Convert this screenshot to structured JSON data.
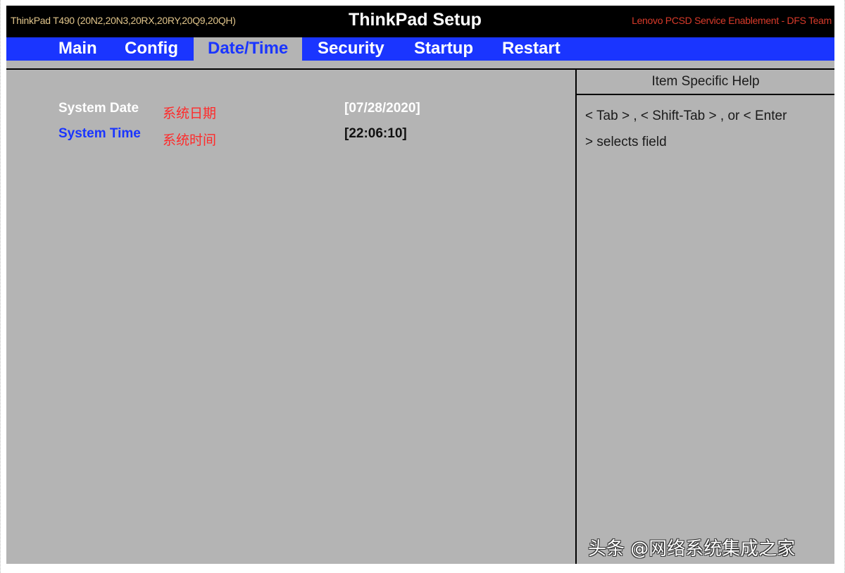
{
  "header": {
    "model": "ThinkPad T490 (20N2,20N3,20RX,20RY,20Q9,20QH)",
    "title": "ThinkPad Setup",
    "team": "Lenovo PCSD Service Enablement - DFS Team"
  },
  "menu": {
    "tabs": [
      {
        "label": "Main"
      },
      {
        "label": "Config"
      },
      {
        "label": "Date/Time",
        "active": true
      },
      {
        "label": "Security"
      },
      {
        "label": "Startup"
      },
      {
        "label": "Restart"
      }
    ]
  },
  "settings": {
    "date": {
      "label": "System Date",
      "annotation": "系统日期",
      "value": "[07/28/2020]"
    },
    "time": {
      "label": "System Time",
      "annotation": "系统时间",
      "value": "[22:06:10]"
    }
  },
  "help": {
    "title": "Item Specific Help",
    "lines": [
      "< Tab > , < Shift-Tab > , or < Enter",
      "> selects field"
    ]
  },
  "watermark": "头条 @网络系统集成之家",
  "colors": {
    "background": "#b4b4b4",
    "menu_bar": "#1a35ff",
    "title_bar": "#000000",
    "annotation": "#ff2a2a"
  }
}
